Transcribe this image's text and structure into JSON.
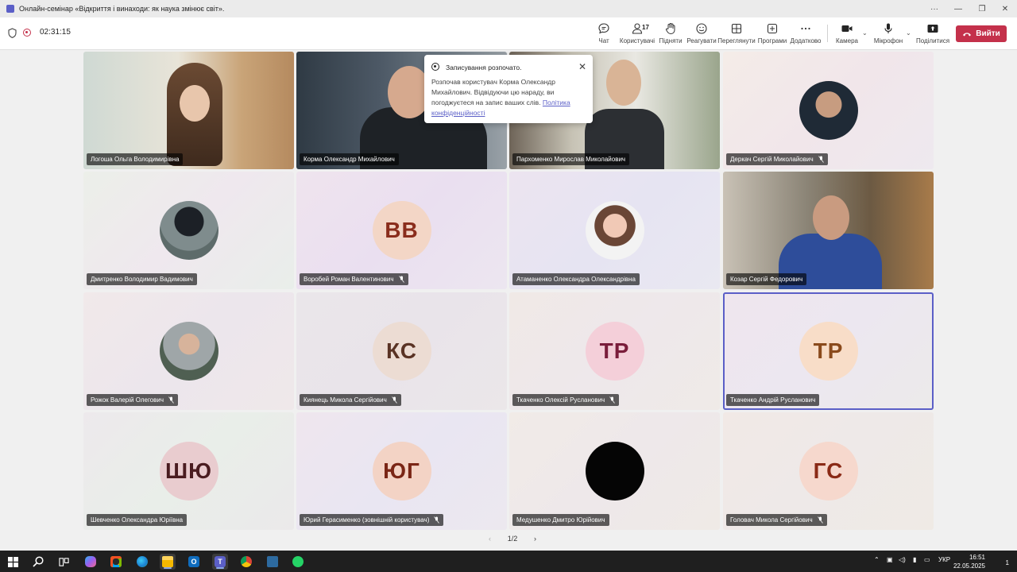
{
  "window": {
    "title": "Онлайн-семінар «Відкриття і винаходи: як наука змінює світ».",
    "controls": [
      "more",
      "minimize",
      "maximize",
      "close"
    ]
  },
  "meeting_bar": {
    "timer": "02:31:15",
    "buttons": {
      "chat": "Чат",
      "people": "Користувачі",
      "people_count": "17",
      "raise": "Підняти",
      "react": "Реагувати",
      "view": "Переглянути",
      "apps": "Програми",
      "more": "Додатково",
      "camera": "Камера",
      "mic": "Мікрофон",
      "share": "Поділитися",
      "leave": "Вийти"
    }
  },
  "toast": {
    "title": "Записування розпочато.",
    "body": "Розпочав користувач Корма Олександр Михайлович. Відвідуючи цю нараду, ви погоджуєтеся на запис ваших слів.",
    "link": "Політика конфіденційності"
  },
  "participants": [
    {
      "name": "Логоша Ольга Володимирівна",
      "type": "video",
      "muted": false
    },
    {
      "name": "Корма Олександр Михайлович",
      "type": "video",
      "muted": false
    },
    {
      "name": "Пархоменко Мирослав Миколайович",
      "type": "video",
      "muted": false
    },
    {
      "name": "Деркач Сергій Миколайович",
      "type": "photo",
      "muted": true
    },
    {
      "name": "Дмитренко Володимир Вадимович",
      "type": "photo",
      "muted": false
    },
    {
      "name": "Воробей Роман Валентинович",
      "type": "initials",
      "initials": "ВВ",
      "muted": true
    },
    {
      "name": "Атаманенко Олександра Олександрівна",
      "type": "photo",
      "muted": false
    },
    {
      "name": "Козар Сергій Федорович",
      "type": "video",
      "muted": false
    },
    {
      "name": "Рожок Валерій Олегович",
      "type": "photo",
      "muted": true
    },
    {
      "name": "Киянець Микола Сергійович",
      "type": "initials",
      "initials": "КС",
      "muted": true
    },
    {
      "name": "Ткаченко Олексій Русланович",
      "type": "initials",
      "initials": "ТР",
      "muted": true
    },
    {
      "name": "Ткаченко Андрій Русланович",
      "type": "initials",
      "initials": "ТР",
      "muted": false
    },
    {
      "name": "Шевченко Олександра Юріївна",
      "type": "initials",
      "initials": "ШЮ",
      "muted": false
    },
    {
      "name": "Юрий Герасименко (зовнішній користувач)",
      "type": "initials",
      "initials": "ЮГ",
      "muted": true
    },
    {
      "name": "Медушенко Дмитро Юрійович",
      "type": "photo",
      "muted": false
    },
    {
      "name": "Головач Микола Сергійович",
      "type": "initials",
      "initials": "ГС",
      "muted": true
    }
  ],
  "pager": {
    "label": "1/2"
  },
  "taskbar": {
    "language": "УКР",
    "time": "16:51",
    "date": "22.05.2025",
    "notifications": "1",
    "apps": [
      "start-icon",
      "search-icon",
      "task-view-icon",
      "copilot-icon",
      "store-icon",
      "edge-icon",
      "file-explorer-icon",
      "outlook-icon",
      "teams-icon",
      "chrome-icon",
      "calculator-icon",
      "whatsapp-icon"
    ]
  }
}
